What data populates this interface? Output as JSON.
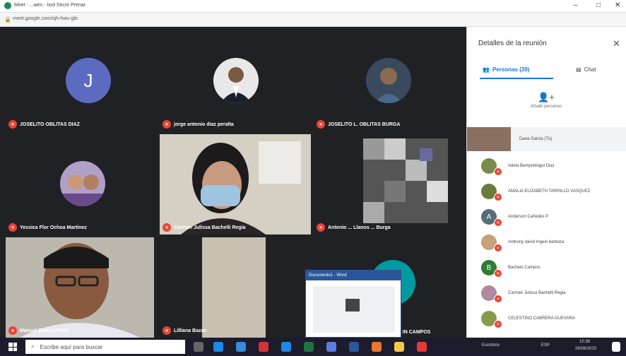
{
  "browser": {
    "title": "Meet - ...wes - hod Secre Prenar",
    "url": "meet.google.com/ojh-hwu-gbi",
    "controls": {
      "min": "–",
      "max": "□",
      "close": "✕"
    }
  },
  "tiles": [
    {
      "name": "JOSELITO OBLITAS DIAZ",
      "avatar_letter": "J",
      "avatar_color": "#5c6bc0"
    },
    {
      "name": "jorge antonio diaz peralta"
    },
    {
      "name": "JOSELITO L. OBLITAS BURGA"
    },
    {
      "name": "Yessica Flor Ochoa Martinez"
    },
    {
      "name": "Carmen Julissa Bachelli Regia"
    },
    {
      "name": "Antonio ... Llanos ... Burga"
    },
    {
      "name": "Manuel Ocaño Pretel"
    },
    {
      "name": "Lilliana Bazan"
    },
    {
      "name": "... IN CAMPOS"
    }
  ],
  "word_popup": {
    "title": "Documento1 - Word"
  },
  "panel": {
    "title": "Detalles de la reunión",
    "tab_people": "Personas (39)",
    "tab_chat": "Chat",
    "add_people": "Añadir personas",
    "people": [
      {
        "name": "Dana Garcia (Tú)",
        "color": "#a0785a"
      },
      {
        "name": "Adela Bemprelingui Diaz",
        "color": "#7a8a4a"
      },
      {
        "name": "AMALIA ELIZABETH TARRILLO VASQUEZ",
        "color": "#6a7a3a"
      },
      {
        "name": "Anderson Cañedes P.",
        "letter": "A",
        "color": "#546e7a"
      },
      {
        "name": "Anthony david Ingein barboza",
        "color": "#c8a07a"
      },
      {
        "name": "Bachelo Campos",
        "letter": "B",
        "color": "#2e7d32"
      },
      {
        "name": "Carmen Julissa Bachelli Regia",
        "color": "#b08aa0"
      },
      {
        "name": "CELESTINO CABRERA GUEVARA",
        "color": "#8a9a4a"
      }
    ]
  },
  "taskbar": {
    "search_placeholder": "Escribe aquí para buscar",
    "tray_label": "Escritorio",
    "tray_lang": "ESP",
    "time": "10:38",
    "date": "26/06/2020"
  }
}
